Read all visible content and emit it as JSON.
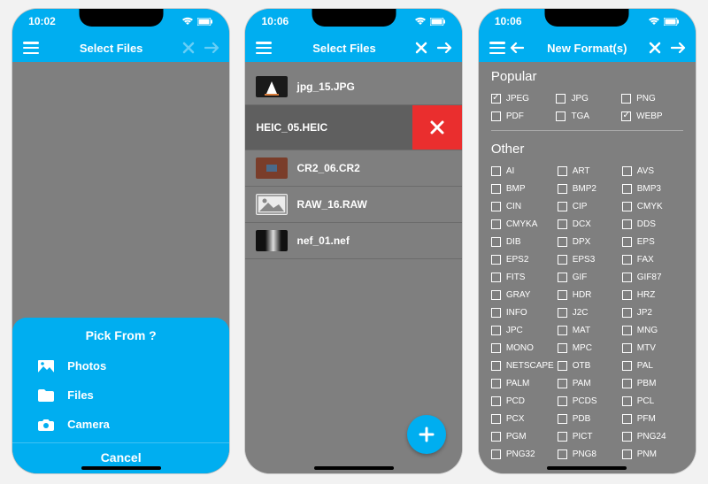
{
  "colors": {
    "accent": "#00aef0",
    "bg": "#7f7f7f",
    "delete": "#ea2e2e"
  },
  "status": {
    "wifi": "wifi-icon",
    "battery": "battery-icon"
  },
  "screen1": {
    "time": "10:02",
    "title": "Select Files",
    "sheet": {
      "title": "Pick From ?",
      "options": [
        {
          "icon": "photo-icon",
          "label": "Photos"
        },
        {
          "icon": "folder-icon",
          "label": "Files"
        },
        {
          "icon": "camera-icon",
          "label": "Camera"
        }
      ],
      "cancel": "Cancel"
    }
  },
  "screen2": {
    "time": "10:06",
    "title": "Select Files",
    "files": [
      {
        "name": "jpg_15.JPG",
        "thumb_color": "#1a1a1a"
      },
      {
        "name": "HEIC_05.HEIC",
        "thumb_color": "#e8e8e8",
        "swiped": true
      },
      {
        "name": "CR2_06.CR2",
        "thumb_color": "#7a3d2a"
      },
      {
        "name": "RAW_16.RAW",
        "thumb_color": "placeholder"
      },
      {
        "name": "nef_01.nef",
        "thumb_color": "#2b2b2b"
      }
    ]
  },
  "screen3": {
    "time": "10:06",
    "title": "New Format(s)",
    "sections": {
      "popular": {
        "label": "Popular",
        "items": [
          {
            "name": "JPEG",
            "checked": true
          },
          {
            "name": "JPG"
          },
          {
            "name": "PNG"
          },
          {
            "name": "PDF"
          },
          {
            "name": "TGA"
          },
          {
            "name": "WEBP",
            "checked": true
          }
        ]
      },
      "other": {
        "label": "Other",
        "items": [
          {
            "name": "AI"
          },
          {
            "name": "ART"
          },
          {
            "name": "AVS"
          },
          {
            "name": "BMP"
          },
          {
            "name": "BMP2"
          },
          {
            "name": "BMP3"
          },
          {
            "name": "CIN"
          },
          {
            "name": "CIP"
          },
          {
            "name": "CMYK"
          },
          {
            "name": "CMYKA"
          },
          {
            "name": "DCX"
          },
          {
            "name": "DDS"
          },
          {
            "name": "DIB"
          },
          {
            "name": "DPX"
          },
          {
            "name": "EPS"
          },
          {
            "name": "EPS2"
          },
          {
            "name": "EPS3"
          },
          {
            "name": "FAX"
          },
          {
            "name": "FITS"
          },
          {
            "name": "GIF"
          },
          {
            "name": "GIF87"
          },
          {
            "name": "GRAY"
          },
          {
            "name": "HDR"
          },
          {
            "name": "HRZ"
          },
          {
            "name": "INFO"
          },
          {
            "name": "J2C"
          },
          {
            "name": "JP2"
          },
          {
            "name": "JPC"
          },
          {
            "name": "MAT"
          },
          {
            "name": "MNG"
          },
          {
            "name": "MONO"
          },
          {
            "name": "MPC"
          },
          {
            "name": "MTV"
          },
          {
            "name": "NETSCAPE"
          },
          {
            "name": "OTB"
          },
          {
            "name": "PAL"
          },
          {
            "name": "PALM"
          },
          {
            "name": "PAM"
          },
          {
            "name": "PBM"
          },
          {
            "name": "PCD"
          },
          {
            "name": "PCDS"
          },
          {
            "name": "PCL"
          },
          {
            "name": "PCX"
          },
          {
            "name": "PDB"
          },
          {
            "name": "PFM"
          },
          {
            "name": "PGM"
          },
          {
            "name": "PICT"
          },
          {
            "name": "PNG24"
          },
          {
            "name": "PNG32"
          },
          {
            "name": "PNG8"
          },
          {
            "name": "PNM"
          }
        ]
      }
    }
  }
}
